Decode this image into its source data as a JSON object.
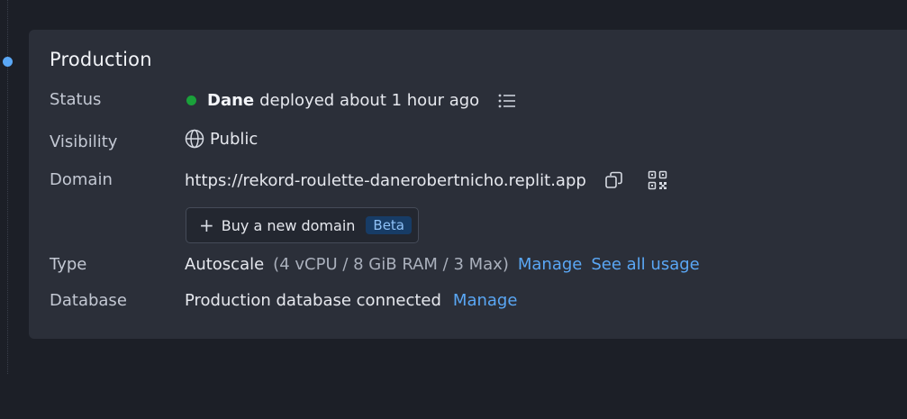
{
  "section": {
    "title": "Production"
  },
  "status": {
    "label": "Status",
    "user": "Dane",
    "text": "deployed about 1 hour ago",
    "dot_color": "#1aa13a",
    "log_icon": "list-icon"
  },
  "visibility": {
    "label": "Visibility",
    "value": "Public",
    "icon": "globe-icon"
  },
  "domain": {
    "label": "Domain",
    "url": "https://rekord-roulette-danerobertnicho.replit.app",
    "copy_icon": "copy-icon",
    "qr_icon": "qr-code-icon",
    "buy_label": "Buy a new domain",
    "buy_badge": "Beta"
  },
  "type": {
    "label": "Type",
    "value": "Autoscale",
    "detail": "(4 vCPU / 8 GiB RAM / 3 Max)",
    "manage_link": "Manage",
    "usage_link": "See all usage"
  },
  "database": {
    "label": "Database",
    "value": "Production database connected",
    "manage_link": "Manage"
  },
  "colors": {
    "accent": "#5aa7f5",
    "background": "#1c1f27",
    "card": "#2b2f39"
  }
}
